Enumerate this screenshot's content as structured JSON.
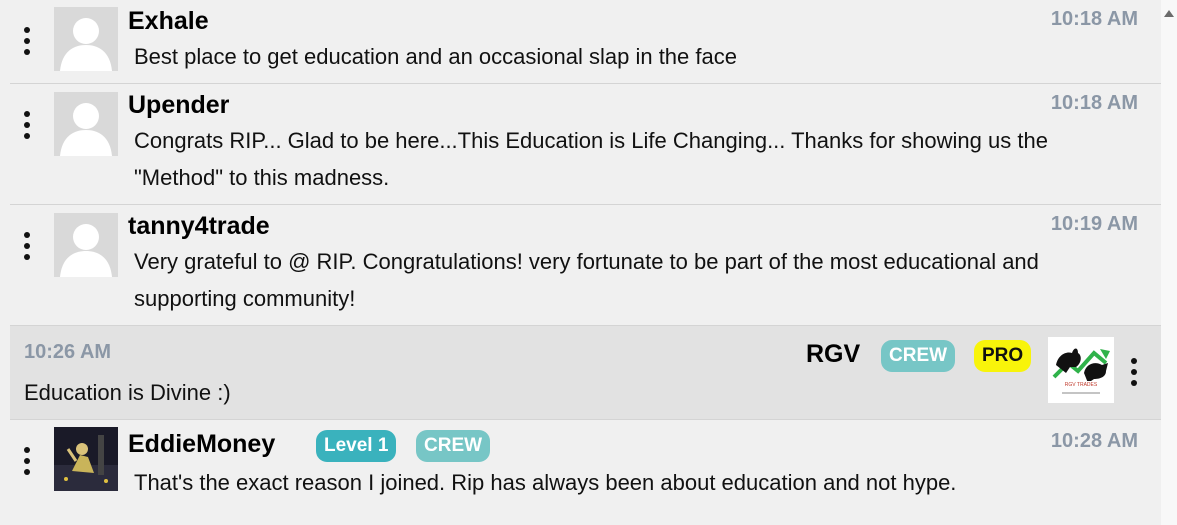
{
  "messages": [
    {
      "username": "Exhale",
      "time": "10:18 AM",
      "text": "Best place to get education and an occasional slap in the face"
    },
    {
      "username": "Upender",
      "time": "10:18 AM",
      "text": "Congrats RIP... Glad to be here...This Education is Life Changing... Thanks for showing us the \"Method\" to this madness."
    },
    {
      "username": "tanny4trade",
      "time": "10:19 AM",
      "text": "Very grateful to @ RIP. Congratulations! very fortunate to be part of the most educational and supporting community!"
    },
    {
      "username": "RGV",
      "time": "10:26 AM",
      "text": "Education is Divine :)",
      "badges": [
        "CREW",
        "PRO"
      ],
      "avatar_caption": "RGV TRADES"
    },
    {
      "username": "EddieMoney",
      "time": "10:28 AM",
      "text": "That's the exact reason I joined. Rip has always been about education and not hype.",
      "badges": [
        "Level 1",
        "CREW"
      ]
    }
  ],
  "colors": {
    "background": "#f0f0f0",
    "own_message_bg": "#e2e2e2",
    "time": "#8b97a6",
    "crew": "#77c6c6",
    "level": "#3ab2bd",
    "pro": "#f8f40a"
  },
  "icons": {
    "menu": "kebab-vertical-icon",
    "avatar": "default-user-icon",
    "scroll": "triangle-up-icon"
  }
}
